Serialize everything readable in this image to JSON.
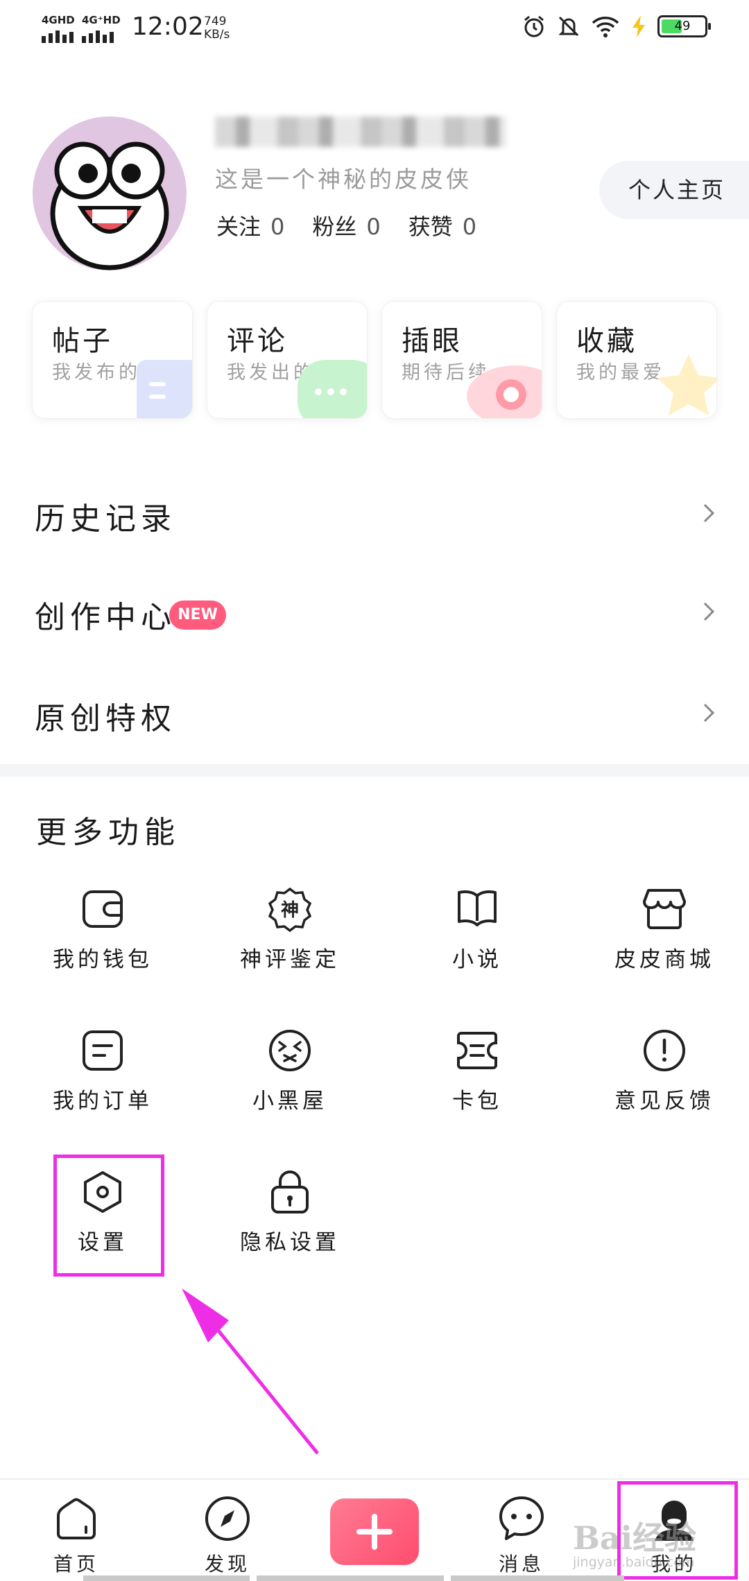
{
  "status_bar": {
    "network1": "4GHD",
    "network2": "4G⁺HD",
    "time": "12:02",
    "speed_value": "749",
    "speed_unit": "KB/s",
    "battery": "49"
  },
  "profile": {
    "bio": "这是一个神秘的皮皮侠",
    "stats": [
      {
        "label": "关注",
        "value": "0"
      },
      {
        "label": "粉丝",
        "value": "0"
      },
      {
        "label": "获赞",
        "value": "0"
      }
    ],
    "homepage_button": "个人主页"
  },
  "cards": [
    {
      "title": "帖子",
      "subtitle": "我发布的",
      "color": "#dde3fb"
    },
    {
      "title": "评论",
      "subtitle": "我发出的",
      "color": "#c8f3cf"
    },
    {
      "title": "插眼",
      "subtitle": "期待后续",
      "color": "#ffd6dc"
    },
    {
      "title": "收藏",
      "subtitle": "我的最爱",
      "color": "#fff0c6"
    }
  ],
  "menu": {
    "history": "历史记录",
    "creator": "创作中心",
    "creator_badge": "NEW",
    "original": "原创特权"
  },
  "more": {
    "title": "更多功能",
    "features": [
      {
        "label": "我的钱包",
        "icon": "wallet-icon"
      },
      {
        "label": "神评鉴定",
        "icon": "seal-icon",
        "glyph": "神"
      },
      {
        "label": "小说",
        "icon": "book-icon"
      },
      {
        "label": "皮皮商城",
        "icon": "shop-icon"
      },
      {
        "label": "我的订单",
        "icon": "order-icon"
      },
      {
        "label": "小黑屋",
        "icon": "dizzy-face-icon"
      },
      {
        "label": "卡包",
        "icon": "card-icon"
      },
      {
        "label": "意见反馈",
        "icon": "feedback-icon"
      },
      {
        "label": "设置",
        "icon": "settings-hexagon-icon"
      },
      {
        "label": "隐私设置",
        "icon": "lock-icon"
      }
    ]
  },
  "bottom_nav": [
    {
      "label": "首页",
      "icon": "home-icon"
    },
    {
      "label": "发现",
      "icon": "compass-icon"
    },
    {
      "label": "",
      "icon": "plus-icon"
    },
    {
      "label": "消息",
      "icon": "chat-icon"
    },
    {
      "label": "我的",
      "icon": "profile-icon"
    }
  ],
  "watermark": {
    "text": "Bai经验",
    "url": "jingyan.baidu.com"
  },
  "colors": {
    "accent": "#ff4d6f",
    "highlight": "#ee2ee6",
    "badge": "#ff5b7d"
  }
}
